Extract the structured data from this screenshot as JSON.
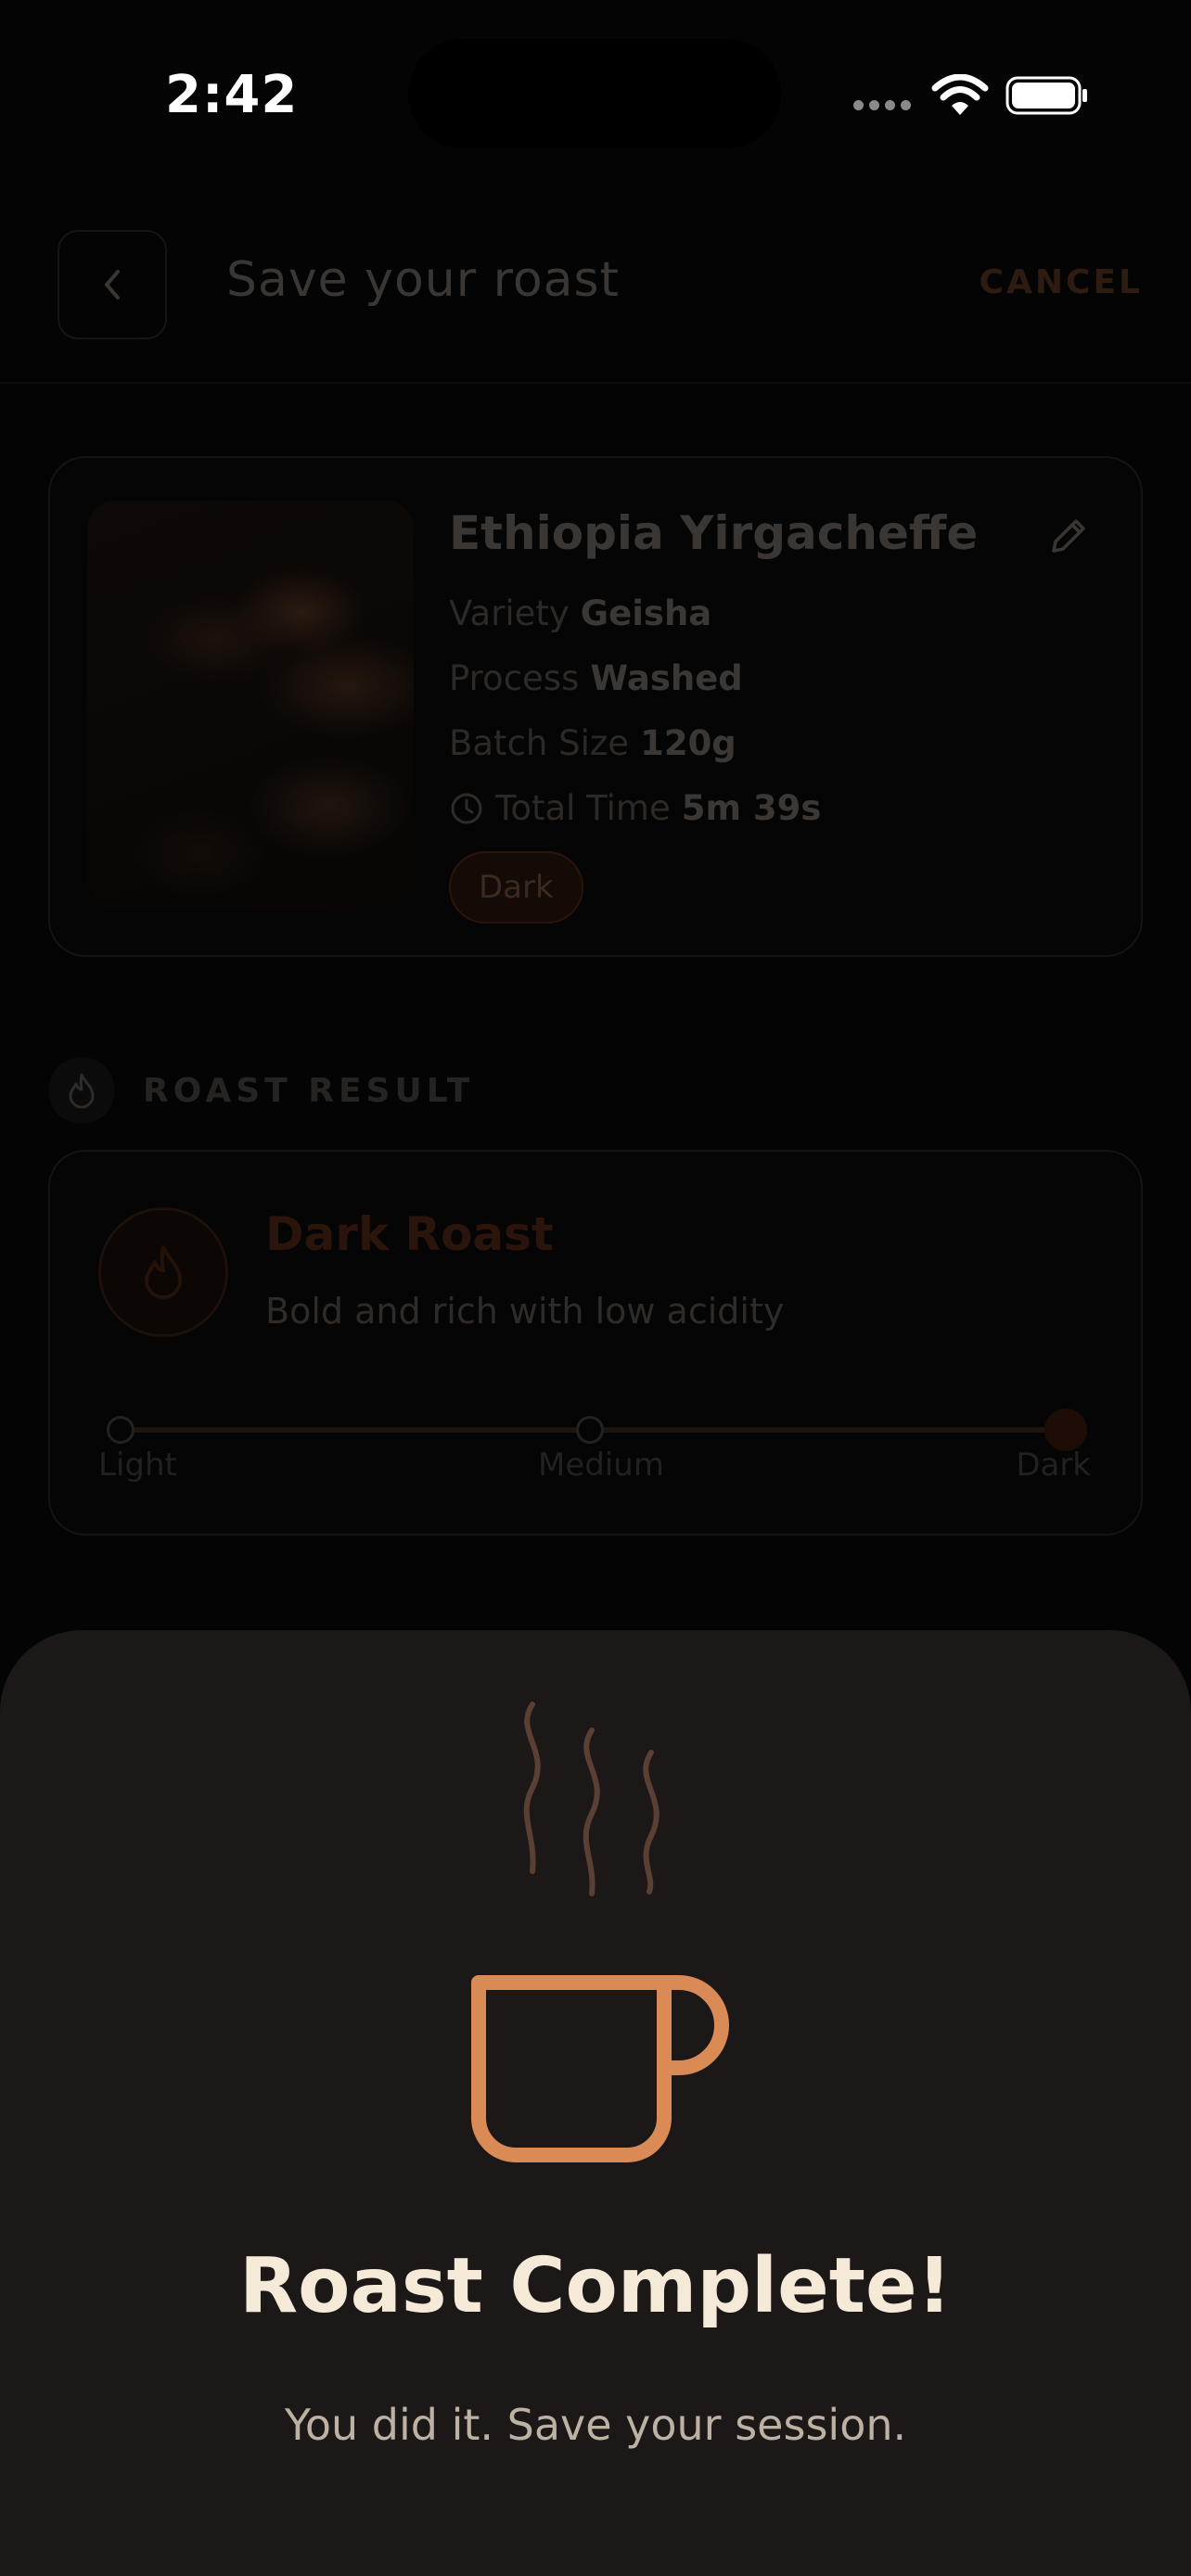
{
  "status_bar": {
    "time": "2:42"
  },
  "header": {
    "title": "Save your roast",
    "cancel_label": "CANCEL"
  },
  "bean": {
    "name": "Ethiopia Yirgacheffe",
    "variety_label": "Variety",
    "variety_value": "Geisha",
    "process_label": "Process",
    "process_value": "Washed",
    "batch_label": "Batch Size",
    "batch_value": "120g",
    "time_label": "Total Time",
    "time_value": "5m 39s",
    "roast_badge": "Dark"
  },
  "roast_result": {
    "section_title": "ROAST RESULT",
    "title": "Dark Roast",
    "description": "Bold and rich with low acidity",
    "levels": [
      "Light",
      "Medium",
      "Dark"
    ],
    "selected_level": "Dark"
  },
  "sheet": {
    "title": "Roast Complete!",
    "subtitle": "You did it. Save your session."
  },
  "colors": {
    "accent": "#d98a55",
    "sheet_bg": "#1c1817",
    "title_text": "#f5e9d8"
  }
}
